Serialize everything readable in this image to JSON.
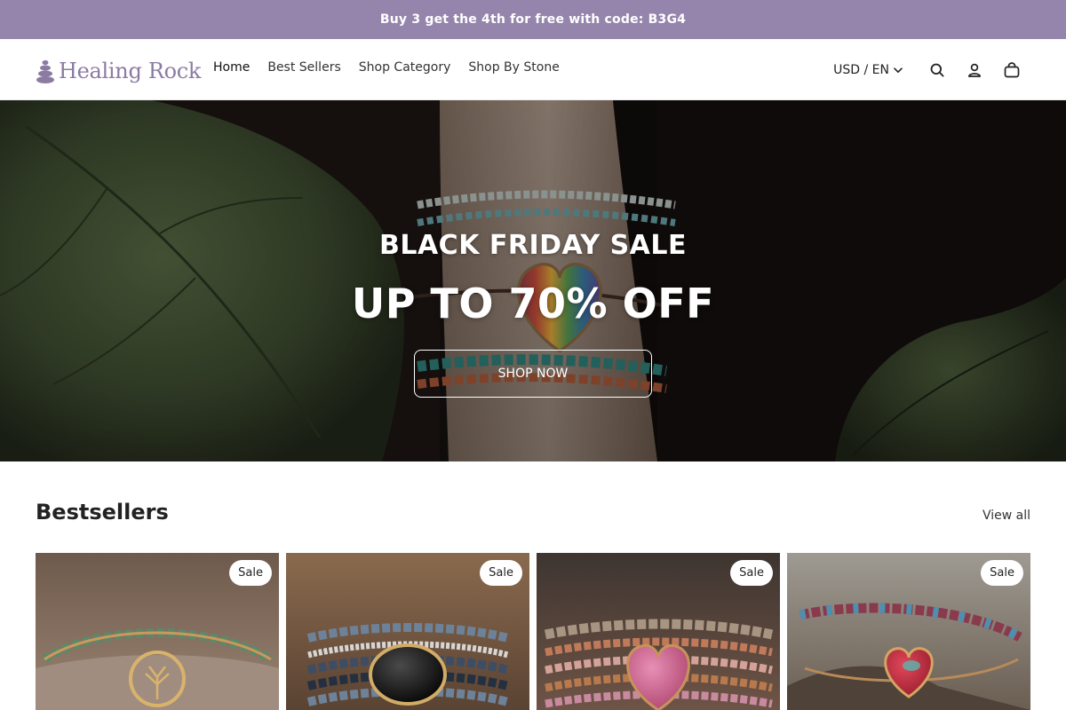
{
  "announcement": {
    "text": "Buy 3 get the 4th for free with code: B3G4"
  },
  "header": {
    "logo_text": "Healing Rock",
    "nav": [
      {
        "label": "Home"
      },
      {
        "label": "Best Sellers"
      },
      {
        "label": "Shop Category"
      },
      {
        "label": "Shop By Stone"
      }
    ],
    "currency_label": "USD / EN",
    "icons": [
      "search-icon",
      "account-icon",
      "cart-icon"
    ]
  },
  "hero": {
    "subtitle": "BLACK FRIDAY SALE",
    "title": "UP TO 70% OFF",
    "button_label": "SHOP NOW"
  },
  "bestsellers": {
    "title": "Bestsellers",
    "view_all_label": "View all",
    "products": [
      {
        "badge": "Sale"
      },
      {
        "badge": "Sale"
      },
      {
        "badge": "Sale"
      },
      {
        "badge": "Sale"
      }
    ]
  },
  "colors": {
    "announcement_bg": "#9585ad",
    "logo": "#8b7ba3",
    "text_dark": "#222222"
  }
}
